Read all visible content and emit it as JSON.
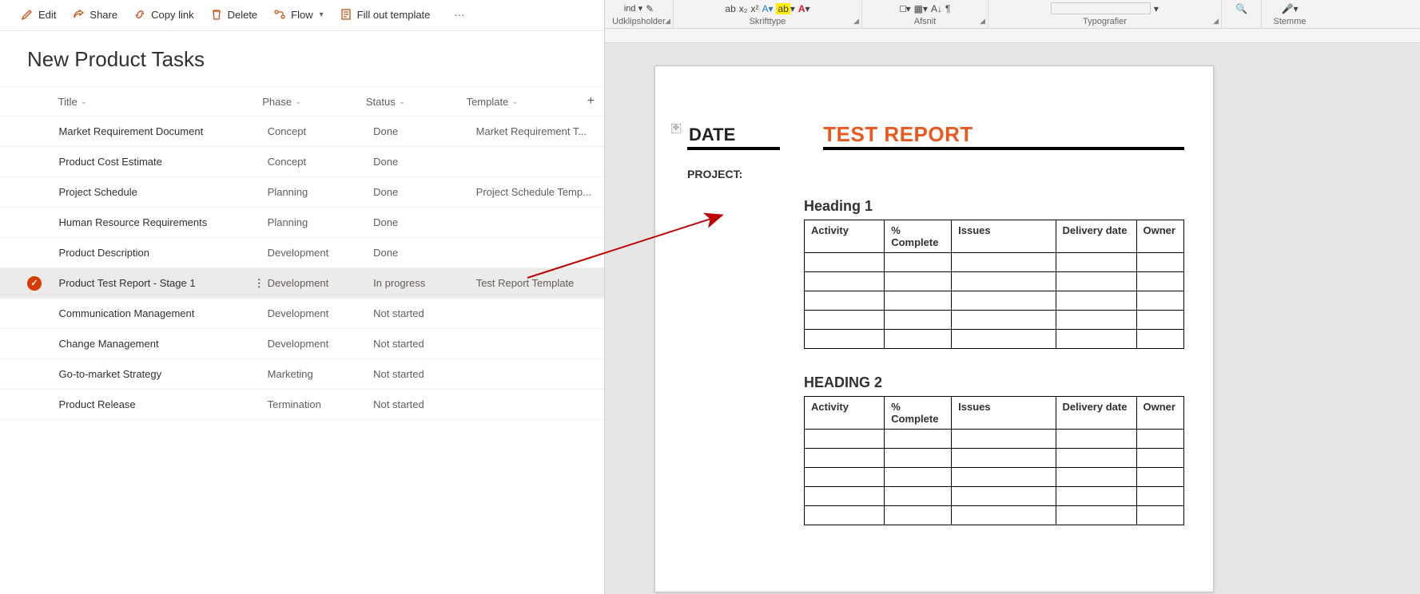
{
  "toolbar": {
    "edit": "Edit",
    "share": "Share",
    "copy_link": "Copy link",
    "delete": "Delete",
    "flow": "Flow",
    "fill_template": "Fill out template",
    "more": "···"
  },
  "list": {
    "title": "New Product Tasks",
    "columns": {
      "title": "Title",
      "phase": "Phase",
      "status": "Status",
      "template": "Template",
      "add": "+"
    },
    "rows": [
      {
        "selected": false,
        "title": "Market Requirement Document",
        "phase": "Concept",
        "status": "Done",
        "template": "Market Requirement T..."
      },
      {
        "selected": false,
        "title": "Product Cost Estimate",
        "phase": "Concept",
        "status": "Done",
        "template": ""
      },
      {
        "selected": false,
        "title": "Project Schedule",
        "phase": "Planning",
        "status": "Done",
        "template": "Project Schedule Temp..."
      },
      {
        "selected": false,
        "title": "Human Resource Requirements",
        "phase": "Planning",
        "status": "Done",
        "template": ""
      },
      {
        "selected": false,
        "title": "Product Description",
        "phase": "Development",
        "status": "Done",
        "template": ""
      },
      {
        "selected": true,
        "title": "Product Test Report - Stage 1",
        "phase": "Development",
        "status": "In progress",
        "template": "Test Report Template"
      },
      {
        "selected": false,
        "title": "Communication Management",
        "phase": "Development",
        "status": "Not started",
        "template": ""
      },
      {
        "selected": false,
        "title": "Change Management",
        "phase": "Development",
        "status": "Not started",
        "template": ""
      },
      {
        "selected": false,
        "title": "Go-to-market Strategy",
        "phase": "Marketing",
        "status": "Not started",
        "template": ""
      },
      {
        "selected": false,
        "title": "Product Release",
        "phase": "Termination",
        "status": "Not started",
        "template": ""
      }
    ]
  },
  "ribbon": {
    "paste_button_hint": "ind",
    "groups": {
      "clipboard": "Udklipsholder",
      "font": "Skrifttype",
      "paragraph": "Afsnit",
      "styles": "Typografier",
      "voice": "Stemme"
    }
  },
  "document": {
    "date_label": "DATE",
    "title": "TEST REPORT",
    "project_label": "PROJECT:",
    "heading1": "Heading 1",
    "heading2": "HEADING 2",
    "table_headers": {
      "activity": "Activity",
      "complete": "% Complete",
      "issues": "Issues",
      "delivery": "Delivery date",
      "owner": "Owner"
    }
  }
}
